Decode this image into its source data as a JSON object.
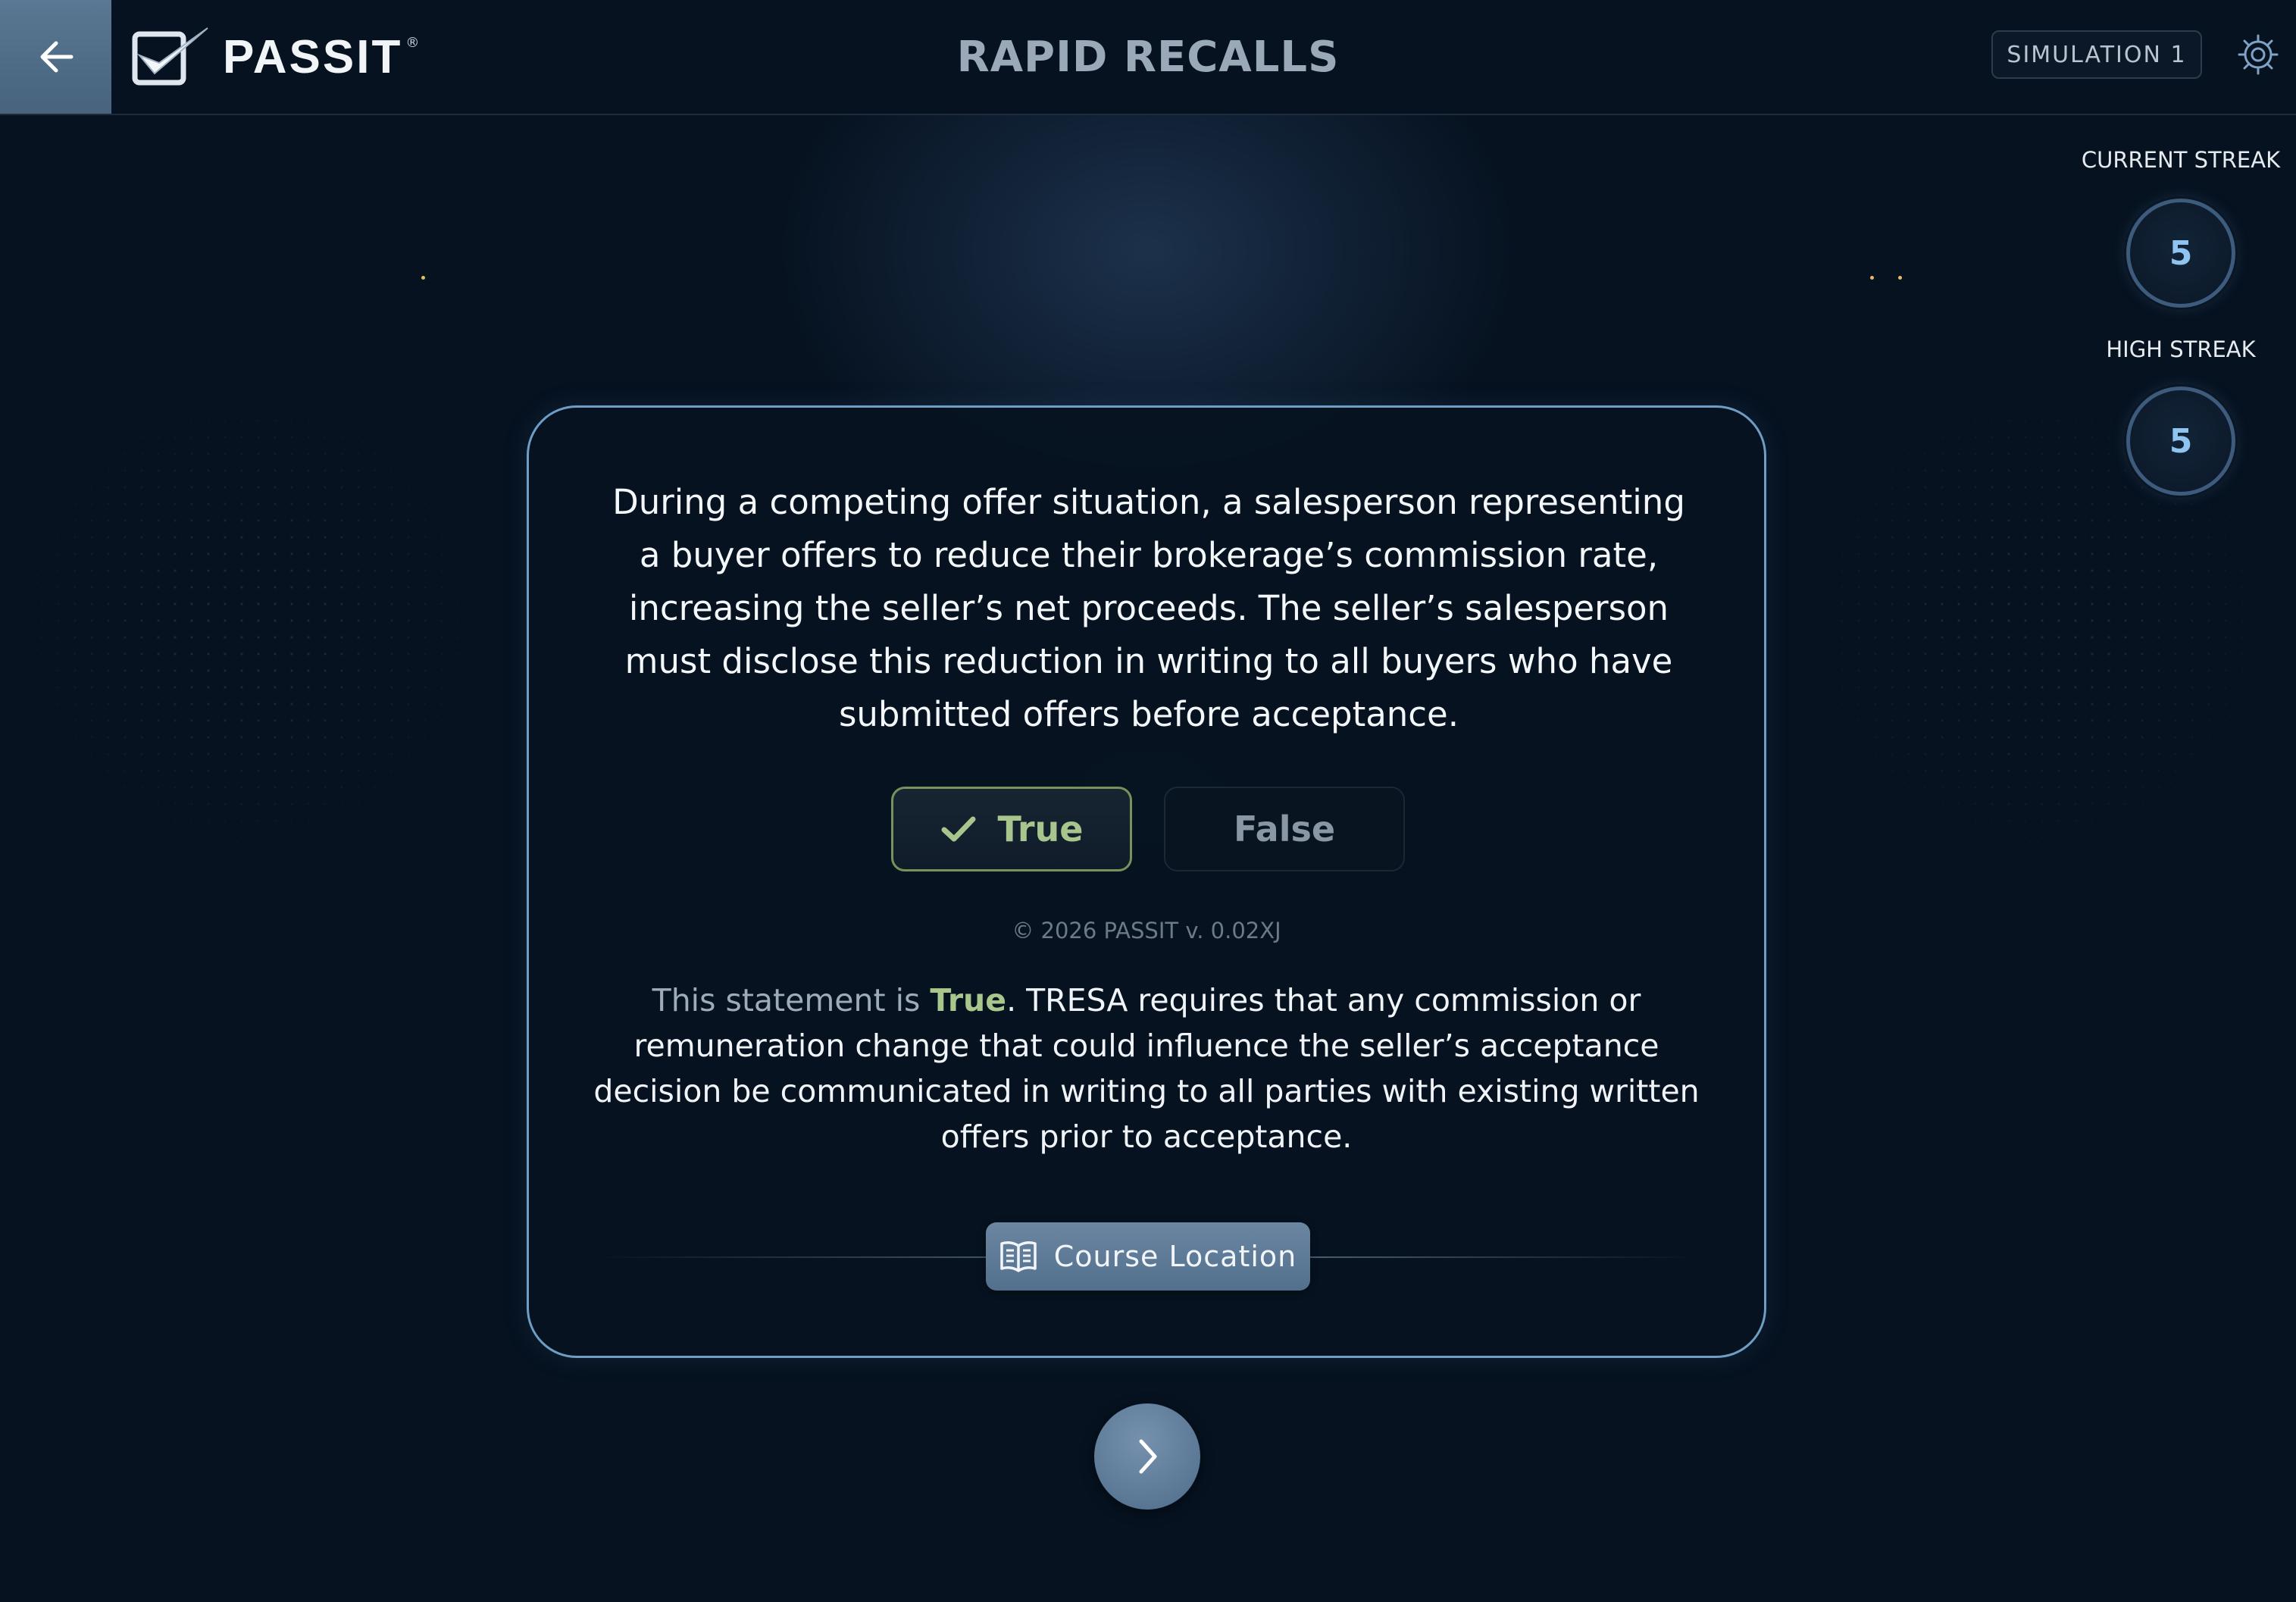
{
  "header": {
    "logo_text": "PASSIT",
    "logo_reg": "®",
    "title": "RAPID RECALLS",
    "simulation_label": "SIMULATION 1",
    "icons": {
      "back": "back-arrow-icon",
      "settings": "gear-icon",
      "logo": "checkmark-logo-icon"
    }
  },
  "streaks": {
    "current_label": "CURRENT STREAK",
    "current_value": "5",
    "high_label": "HIGH STREAK",
    "high_value": "5"
  },
  "card": {
    "question": "During a competing offer situation, a salesperson representing a buyer offers to reduce their brokerage’s commission rate, increasing the seller’s net proceeds. The seller’s salesperson must disclose this reduction in writing to all buyers who have submitted offers before acceptance.",
    "true_label": "True",
    "false_label": "False",
    "selected_answer": "True",
    "copyright": "© 2026 PASSIT v. 0.02XJ",
    "explanation_prefix": "This statement is ",
    "explanation_verdict": "True",
    "explanation_body": ". TRESA requires that any commission or remuneration change that could influence the seller’s acceptance decision be communicated in writing to all parties with existing written offers prior to acceptance.",
    "course_location_label": "Course Location"
  },
  "navigation": {
    "next_icon": "chevron-right-icon"
  },
  "colors": {
    "background": "#061220",
    "card_border": "#6f9dc4",
    "true_accent": "#a7c58c",
    "streak_value": "#8fc3f0",
    "button_fill": "#5f7c98"
  }
}
